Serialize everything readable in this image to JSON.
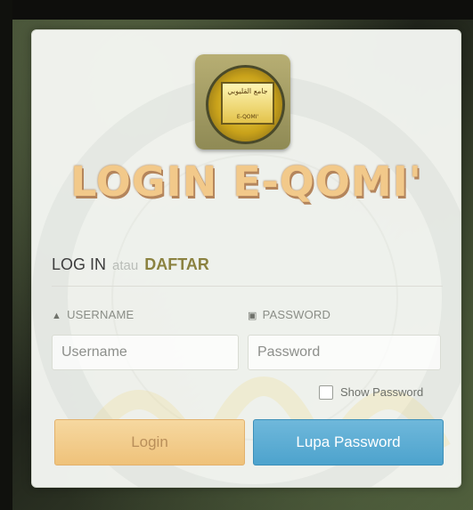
{
  "logo": {
    "arabic_text": "جامع القليوبي",
    "sub_text": "E-QOMI'"
  },
  "title": "LOGIN E-QOMI'",
  "headline": {
    "login": "LOG IN",
    "connector": "atau",
    "register": "DAFTAR"
  },
  "form": {
    "username": {
      "label": "USERNAME",
      "icon": "user-icon",
      "placeholder": "Username",
      "value": ""
    },
    "password": {
      "label": "PASSWORD",
      "icon": "lock-icon",
      "placeholder": "Password",
      "value": ""
    },
    "show_password": {
      "label": "Show Password",
      "checked": false
    }
  },
  "buttons": {
    "login": "Login",
    "forgot": "Lupa Password"
  },
  "colors": {
    "title": "#f2c98a",
    "register_link": "#8b8240",
    "login_button": "#efc27a",
    "forgot_button": "#4da3cd"
  }
}
